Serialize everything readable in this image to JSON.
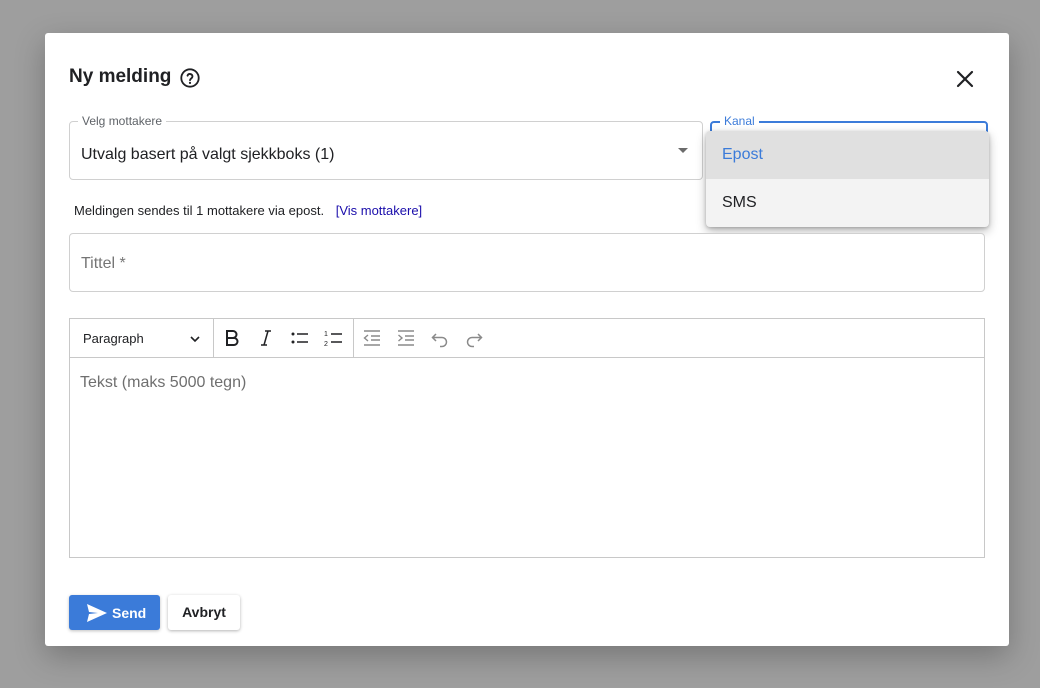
{
  "dialog": {
    "title": "Ny melding",
    "help_icon": "help-circle-icon",
    "close_icon": "close-icon"
  },
  "recipients": {
    "label": "Velg mottakere",
    "value": "Utvalg basert på valgt sjekkboks (1)"
  },
  "channel": {
    "label": "Kanal",
    "options": [
      {
        "label": "Epost",
        "selected": true
      },
      {
        "label": "SMS",
        "selected": false
      }
    ]
  },
  "info": {
    "prefix": "Meldingen sendes til ",
    "count": "1",
    "middle": " mottakere via ",
    "channel": "epost",
    "suffix": ".",
    "link": "[Vis mottakere]"
  },
  "title_field": {
    "placeholder": "Tittel *"
  },
  "editor": {
    "block_format": "Paragraph",
    "placeholder": "Tekst (maks 5000 tegn)",
    "tools": [
      "bold-icon",
      "italic-icon",
      "bullet-list-icon",
      "numbered-list-icon",
      "outdent-icon",
      "indent-icon",
      "undo-icon",
      "redo-icon"
    ]
  },
  "actions": {
    "send": "Send",
    "cancel": "Avbryt"
  },
  "colors": {
    "accent": "#3b7bd9",
    "link": "#1a0dab",
    "overlay": "#9e9e9e"
  }
}
